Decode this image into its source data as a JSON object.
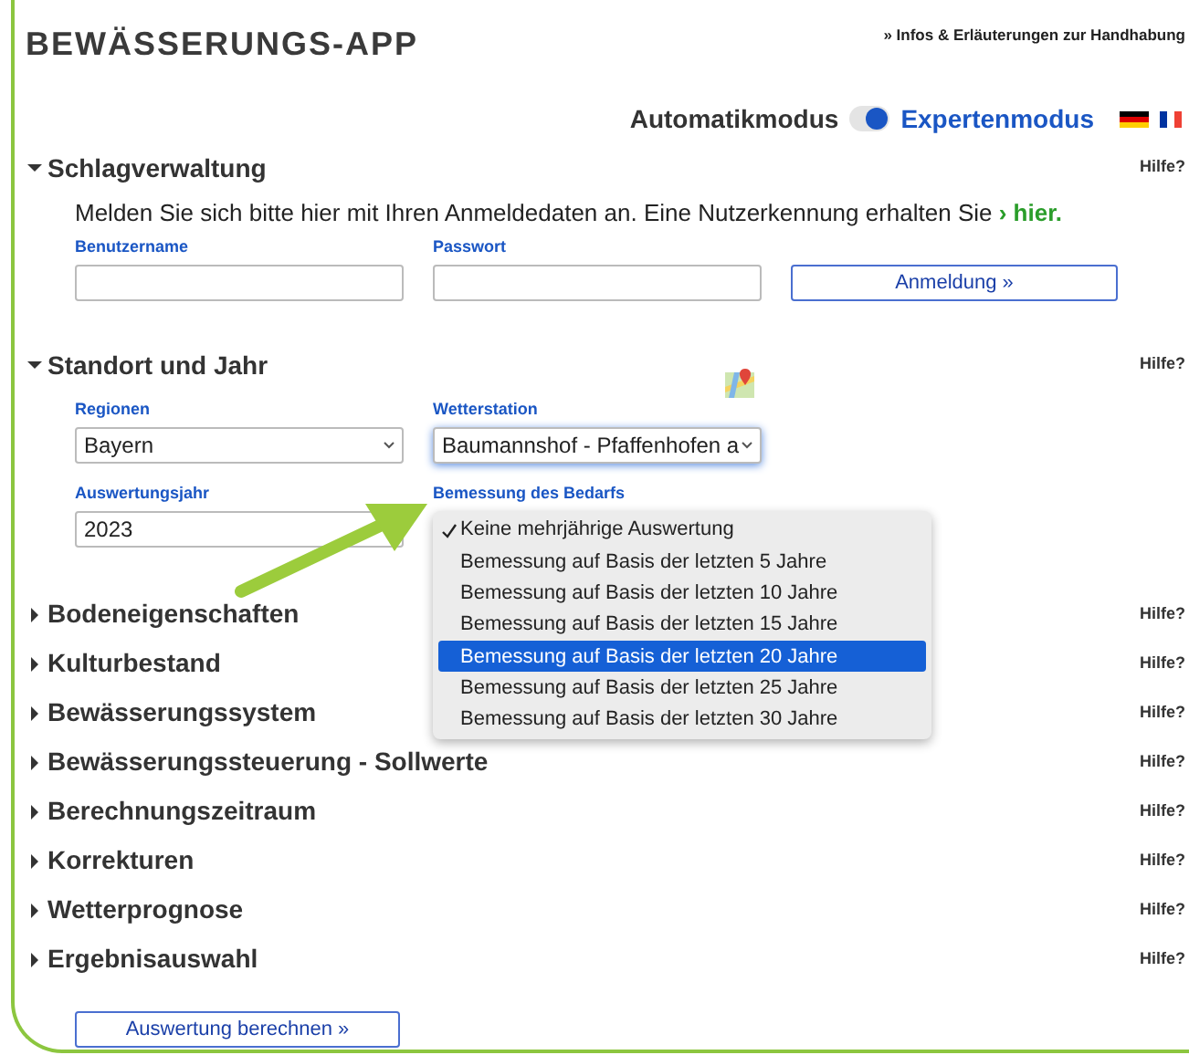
{
  "header": {
    "title": "BEWÄSSERUNGS-APP",
    "info_link": "» Infos & Erläuterungen zur Handhabung"
  },
  "mode": {
    "left_label": "Automatikmodus",
    "right_label": "Expertenmodus",
    "expert": true
  },
  "sections": [
    {
      "title": "Schlagverwaltung",
      "expanded": true,
      "help": "Hilfe?",
      "kind": "login",
      "intro": "Melden Sie sich bitte hier mit Ihren Anmeldedaten an. Eine Nutzerkennung erhalten Sie",
      "intro_link": "› hier.",
      "fields": [
        {
          "label": "Benutzername"
        },
        {
          "label": "Passwort"
        }
      ],
      "button": "Anmeldung »"
    },
    {
      "title": "Standort und Jahr",
      "expanded": true,
      "help": "Hilfe?",
      "kind": "location",
      "fields": [
        {
          "label": "Regionen",
          "kind": "select",
          "value": "Bayern",
          "focused": false
        },
        {
          "label": "Wetterstation",
          "kind": "select",
          "value": "Baumannshof - Pfaffenhofen a",
          "focused": true
        },
        {
          "label": "Auswertungsjahr",
          "kind": "input",
          "value": "2023"
        },
        {
          "label": "Bemessung des Bedarfs",
          "kind": "menu",
          "options": [
            {
              "label": "Keine mehrjährige Auswertung",
              "checked": true,
              "selected": false
            },
            {
              "label": "Bemessung auf Basis der letzten 5 Jahre",
              "checked": false,
              "selected": false
            },
            {
              "label": "Bemessung auf Basis der letzten 10 Jahre",
              "checked": false,
              "selected": false
            },
            {
              "label": "Bemessung auf Basis der letzten 15 Jahre",
              "checked": false,
              "selected": false
            },
            {
              "label": "Bemessung auf Basis der letzten 20 Jahre",
              "checked": false,
              "selected": true
            },
            {
              "label": "Bemessung auf Basis der letzten 25 Jahre",
              "checked": false,
              "selected": false
            },
            {
              "label": "Bemessung auf Basis der letzten 30 Jahre",
              "checked": false,
              "selected": false
            }
          ]
        }
      ]
    },
    {
      "title": "Bodeneigenschaften",
      "expanded": false,
      "help": "Hilfe?"
    },
    {
      "title": "Kulturbestand",
      "expanded": false,
      "help": "Hilfe?"
    },
    {
      "title": "Bewässerungssystem",
      "expanded": false,
      "help": "Hilfe?"
    },
    {
      "title": "Bewässerungssteuerung - Sollwerte",
      "expanded": false,
      "help": "Hilfe?"
    },
    {
      "title": "Berechnungszeitraum",
      "expanded": false,
      "help": "Hilfe?"
    },
    {
      "title": "Korrekturen",
      "expanded": false,
      "help": "Hilfe?"
    },
    {
      "title": "Wetterprognose",
      "expanded": false,
      "help": "Hilfe?"
    },
    {
      "title": "Ergebnisauswahl",
      "expanded": false,
      "help": "Hilfe?"
    }
  ],
  "submit_button": "Auswertung berechnen »"
}
